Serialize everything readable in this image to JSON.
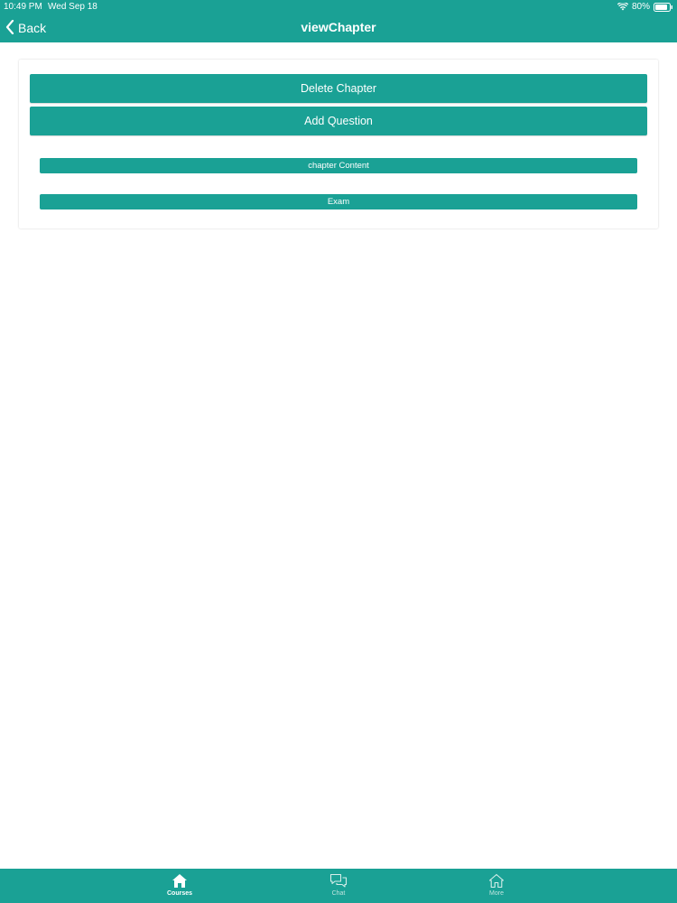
{
  "status_bar": {
    "time": "10:49 PM",
    "date": "Wed Sep 18",
    "battery": "80%",
    "wifi_icon": "wifi-icon",
    "battery_icon": "battery-icon"
  },
  "nav": {
    "back_label": "Back",
    "back_icon": "chevron-left-icon",
    "title": "viewChapter"
  },
  "card": {
    "delete_label": "Delete Chapter",
    "add_label": "Add Question",
    "content_label": "chapter Content",
    "exam_label": "Exam"
  },
  "tabs": [
    {
      "label": "Courses",
      "icon": "home-icon",
      "active": true
    },
    {
      "label": "Chat",
      "icon": "chat-icon",
      "active": false
    },
    {
      "label": "More",
      "icon": "home-outline-icon",
      "active": false
    }
  ],
  "colors": {
    "primary": "#1aa195",
    "background": "#ffffff",
    "text_on_primary": "#ffffff",
    "inactive_tab": "#bfe4df"
  }
}
